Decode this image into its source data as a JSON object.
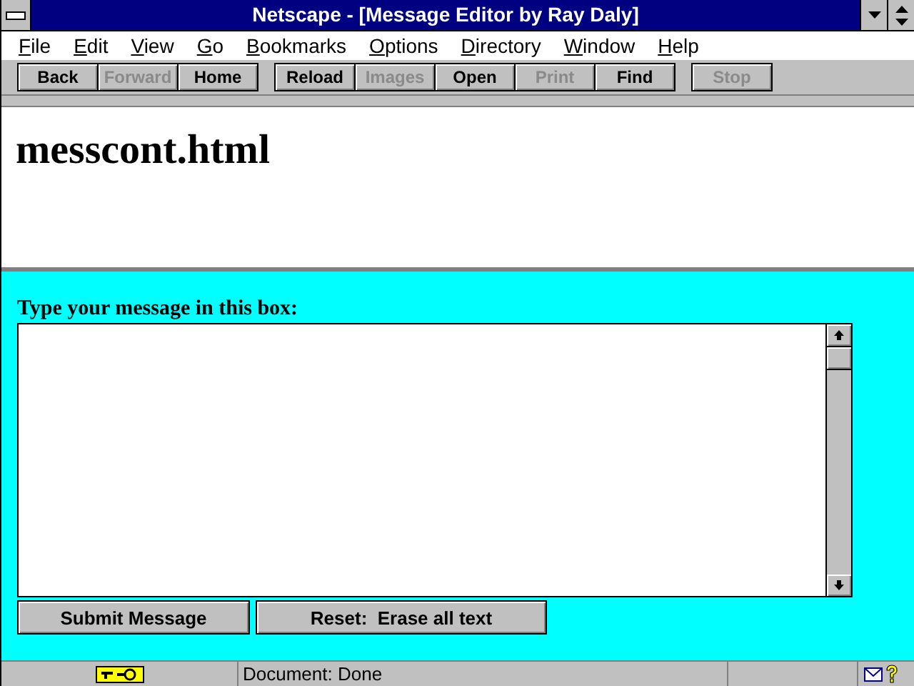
{
  "window": {
    "title": "Netscape - [Message Editor by Ray Daly]"
  },
  "menu": [
    "File",
    "Edit",
    "View",
    "Go",
    "Bookmarks",
    "Options",
    "Directory",
    "Window",
    "Help"
  ],
  "toolbar": [
    [
      {
        "label": "Back",
        "disabled": false
      },
      {
        "label": "Forward",
        "disabled": true
      },
      {
        "label": "Home",
        "disabled": false
      }
    ],
    [
      {
        "label": "Reload",
        "disabled": false
      },
      {
        "label": "Images",
        "disabled": true
      },
      {
        "label": "Open",
        "disabled": false
      },
      {
        "label": "Print",
        "disabled": true
      },
      {
        "label": "Find",
        "disabled": false
      }
    ],
    [
      {
        "label": "Stop",
        "disabled": true
      }
    ]
  ],
  "top_frame": {
    "heading": "messcont.html"
  },
  "form": {
    "label": "Type your message in this box:",
    "buttons": [
      "Submit Message",
      "Reset:  Erase all text"
    ]
  },
  "status_bar": {
    "text": "Document: Done"
  }
}
